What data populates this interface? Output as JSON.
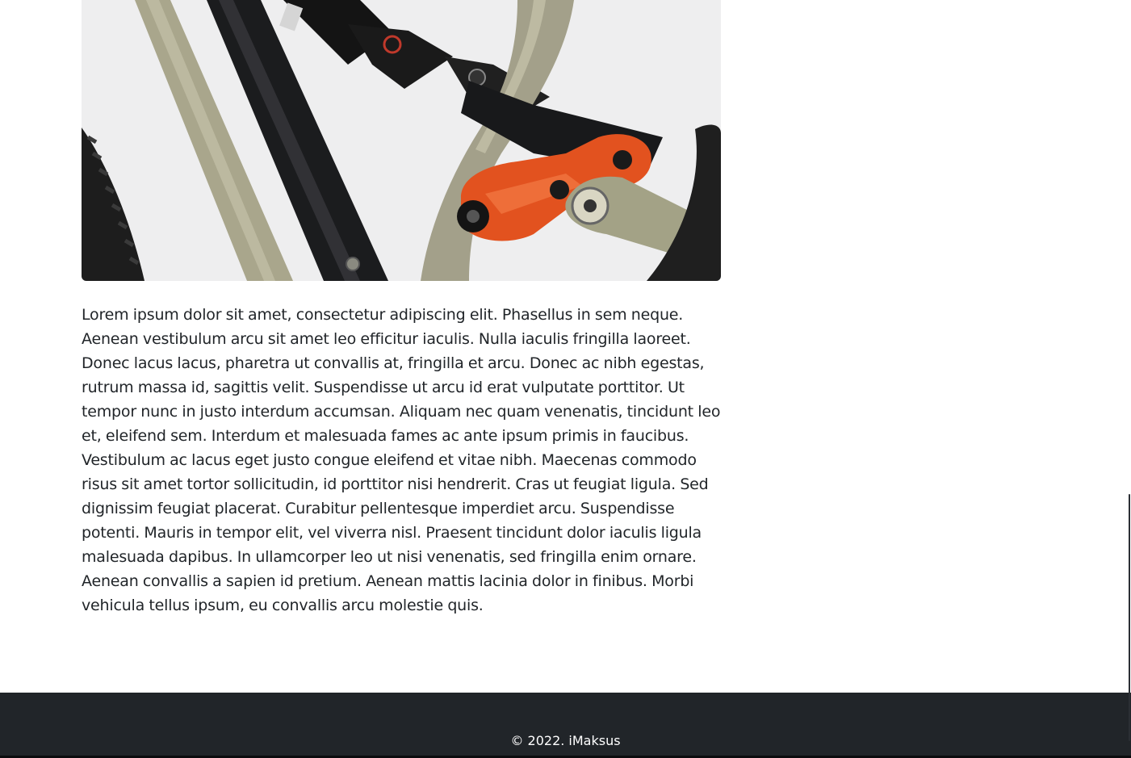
{
  "article": {
    "image": {
      "alt": "",
      "subject_icon": "mountain-bike-rear-suspension",
      "colors": {
        "background": "#eeeeee",
        "frame_olive": "#a7a389",
        "frame_black": "#1c1d1f",
        "rocker_orange": "#e2511f",
        "shock_black": "#141414",
        "tire": "#1d1d1d"
      }
    },
    "body": "Lorem ipsum dolor sit amet, consectetur adipiscing elit. Phasellus in sem neque. Aenean vestibulum arcu sit amet leo efficitur iaculis. Nulla iaculis fringilla laoreet. Donec lacus lacus, pharetra ut convallis at, fringilla et arcu. Donec ac nibh egestas, rutrum massa id, sagittis velit. Suspendisse ut arcu id erat vulputate porttitor. Ut tempor nunc in justo interdum accumsan. Aliquam nec quam venenatis, tincidunt leo et, eleifend sem. Interdum et malesuada fames ac ante ipsum primis in faucibus. Vestibulum ac lacus eget justo congue eleifend et vitae nibh. Maecenas commodo risus sit amet tortor sollicitudin, id porttitor nisi hendrerit. Cras ut feugiat ligula. Sed dignissim feugiat placerat. Curabitur pellentesque imperdiet arcu. Suspendisse potenti. Mauris in tempor elit, vel viverra nisl. Praesent tincidunt dolor iaculis ligula malesuada dapibus. In ullamcorper leo ut nisi venenatis, sed fringilla enim ornare. Aenean convallis a sapien id pretium. Aenean mattis lacinia dolor in finibus. Morbi vehicula tellus ipsum, eu convallis arcu molestie quis."
  },
  "footer": {
    "copyright": "© 2022. iMaksus",
    "background": "#212529",
    "text_color": "#ffffff"
  },
  "scrollbar": {
    "position_percent": 65
  }
}
